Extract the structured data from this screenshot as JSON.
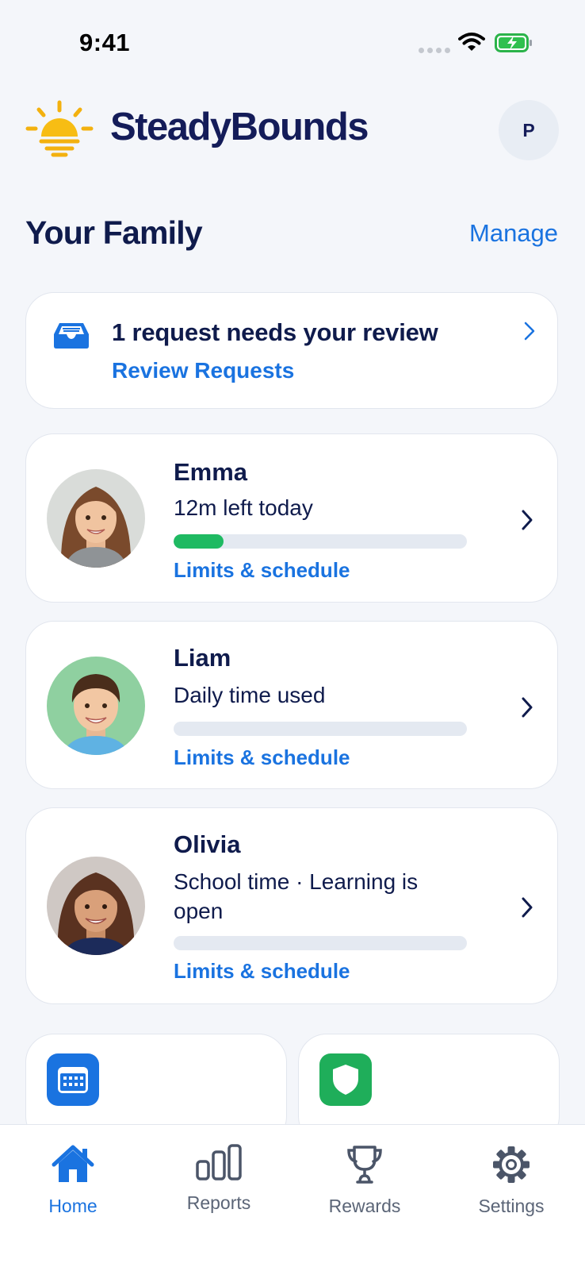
{
  "status_bar": {
    "time": "9:41"
  },
  "header": {
    "app_name": "SteadyBounds",
    "avatar_initial": "P"
  },
  "family": {
    "title": "Your Family",
    "manage_label": "Manage"
  },
  "request": {
    "title": "1 request needs your review",
    "link_label": "Review Requests"
  },
  "children": [
    {
      "name": "Emma",
      "status": "12m left today",
      "progress": 0.17,
      "link_label": "Limits & schedule",
      "photo_bg": "#d9dcd9"
    },
    {
      "name": "Liam",
      "status": "Daily time used",
      "progress": 0,
      "link_label": "Limits & schedule",
      "photo_bg": "#8fd0a0"
    },
    {
      "name": "Olivia",
      "status": "School time · Learning is open",
      "progress": 0,
      "link_label": "Limits & schedule",
      "photo_bg": "#cfc8c4"
    }
  ],
  "tiles": [
    {
      "icon": "calendar-icon",
      "color": "#1a73e0"
    },
    {
      "icon": "shield-icon",
      "color": "#1fae5a"
    }
  ],
  "tabbar": {
    "items": [
      {
        "label": "Home",
        "icon": "home-icon",
        "active": true
      },
      {
        "label": "Reports",
        "icon": "bar-chart-icon",
        "active": false
      },
      {
        "label": "Rewards",
        "icon": "trophy-icon",
        "active": false
      },
      {
        "label": "Settings",
        "icon": "gear-icon",
        "active": false
      }
    ]
  },
  "colors": {
    "accent": "#1a73e0",
    "progress": "#1fba62",
    "title": "#0f1b4c"
  }
}
